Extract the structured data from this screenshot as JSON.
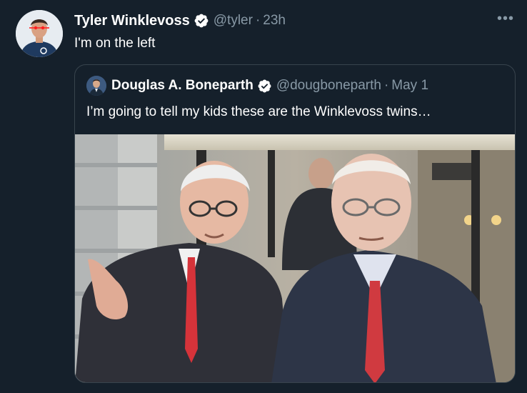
{
  "tweet": {
    "author_name": "Tyler Winklevoss",
    "handle": "@tyler",
    "separator": "·",
    "time": "23h",
    "text": "I'm on the left",
    "more_label": "•••"
  },
  "quoted_tweet": {
    "author_name": "Douglas A. Boneparth",
    "handle": "@dougboneparth",
    "separator": "·",
    "time": "May 1",
    "text": "I’m going to tell my kids these are the Winklevoss twins…"
  },
  "colors": {
    "background": "#15202b",
    "secondary_text": "#8899a6",
    "border": "#38444d",
    "verified_badge": "#ffffff"
  },
  "icons": {
    "verified": "verified-badge-icon",
    "more": "more-horizontal-icon"
  }
}
